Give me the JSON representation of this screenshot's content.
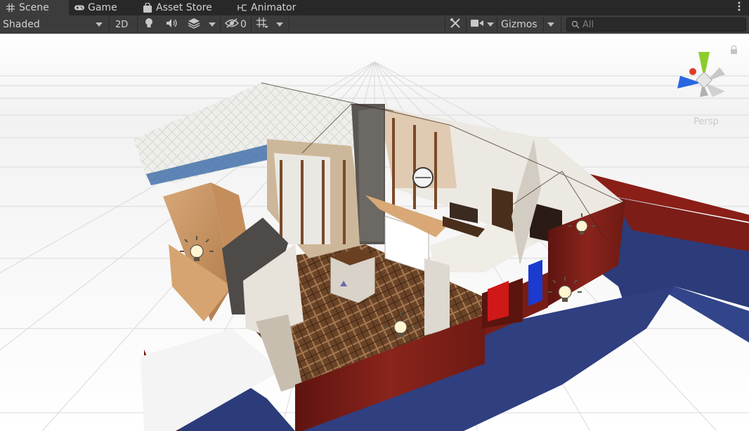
{
  "tabs": [
    {
      "label": "Scene",
      "icon": "grid-icon",
      "active": true
    },
    {
      "label": "Game",
      "icon": "gamepad-icon",
      "active": false
    },
    {
      "label": "Asset Store",
      "icon": "shopping-bag-icon",
      "active": false
    },
    {
      "label": "Animator",
      "icon": "animator-icon",
      "active": false
    }
  ],
  "toolbar": {
    "shading_mode": "Shaded",
    "mode_2d_label": "2D",
    "hidden_count": "0",
    "gizmos_label": "Gizmos"
  },
  "search": {
    "placeholder": "All",
    "icon": "search-icon"
  },
  "viewport": {
    "projection_label": "Persp",
    "colors": {
      "sky": "#ffffff",
      "grid_line": "#d6d6d6",
      "red_wall": "#7c1d18",
      "blue_floor": "#2c3c7a",
      "wood_floor": "#6b4428"
    }
  },
  "icons": {
    "lighting": "bulb-icon",
    "audio": "speaker-icon",
    "effects": "layers-icon",
    "visibility": "eye-slash-icon",
    "grid": "grid-snap-icon",
    "tools": "tools-icon",
    "camera": "camera-icon",
    "lock": "lock-icon",
    "more": "kebab-menu-icon",
    "light_gizmo": "light-bulb-gizmo-icon",
    "orientation": "scene-orientation-gizmo"
  }
}
